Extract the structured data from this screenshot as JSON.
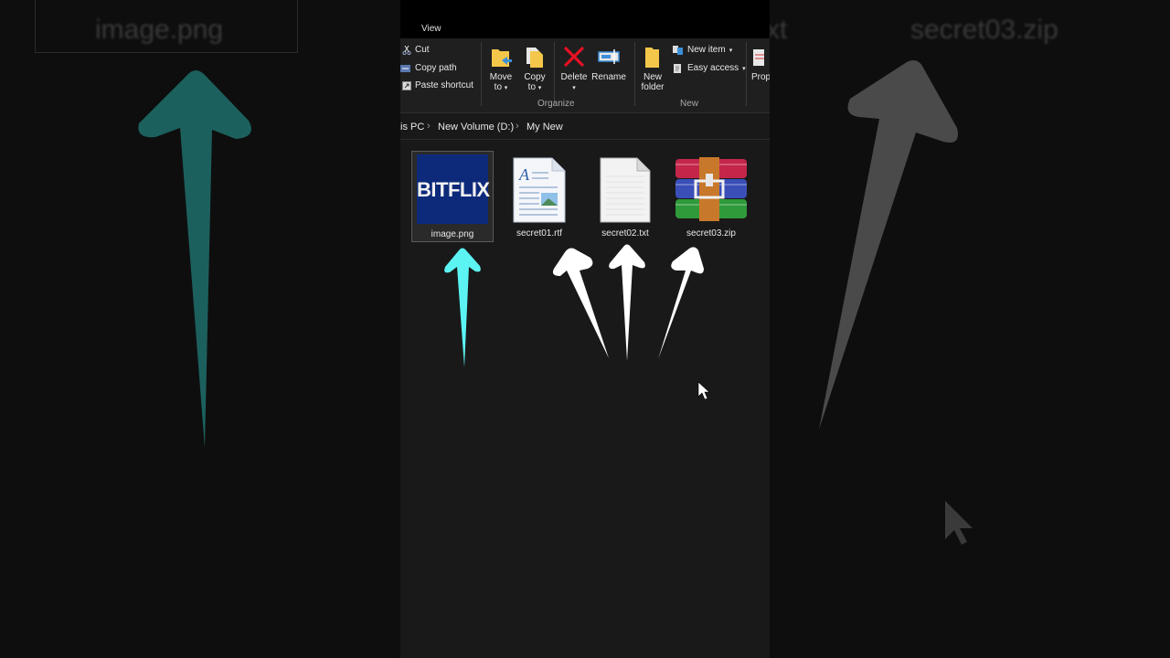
{
  "background": {
    "left_label": "image.png",
    "right_label_1": "secret03.zip",
    "right_label_2": "xt",
    "left_arrow_color": "#1f6f6c",
    "right_arrow_color": "#5a5a5a"
  },
  "tabs": {
    "view": "View"
  },
  "ribbon": {
    "clipboard": {
      "cut": "Cut",
      "copy_path": "Copy path",
      "paste_shortcut": "Paste shortcut"
    },
    "organize": {
      "move_to_line1": "Move",
      "move_to_line2": "to",
      "copy_to_line1": "Copy",
      "copy_to_line2": "to",
      "delete": "Delete",
      "rename": "Rename",
      "group": "Organize"
    },
    "new": {
      "new_folder_line1": "New",
      "new_folder_line2": "folder",
      "new_item": "New item",
      "easy_access": "Easy access",
      "group": "New"
    },
    "open": {
      "properties": "Prop"
    }
  },
  "address": {
    "crumbs": [
      "is PC",
      "New Volume (D:)",
      "My New"
    ]
  },
  "files": [
    {
      "name": "image.png",
      "thumb_text": "BITFLIX",
      "selected": true
    },
    {
      "name": "secret01.rtf",
      "selected": false
    },
    {
      "name": "secret02.txt",
      "selected": false
    },
    {
      "name": "secret03.zip",
      "selected": false
    }
  ],
  "colors": {
    "cyan_arrow": "#5cf3f3",
    "white_arrow": "#ffffff",
    "delete_red": "#e81123",
    "folder_yellow": "#f4c74a",
    "bitflix_bg": "#0d2a7a"
  }
}
